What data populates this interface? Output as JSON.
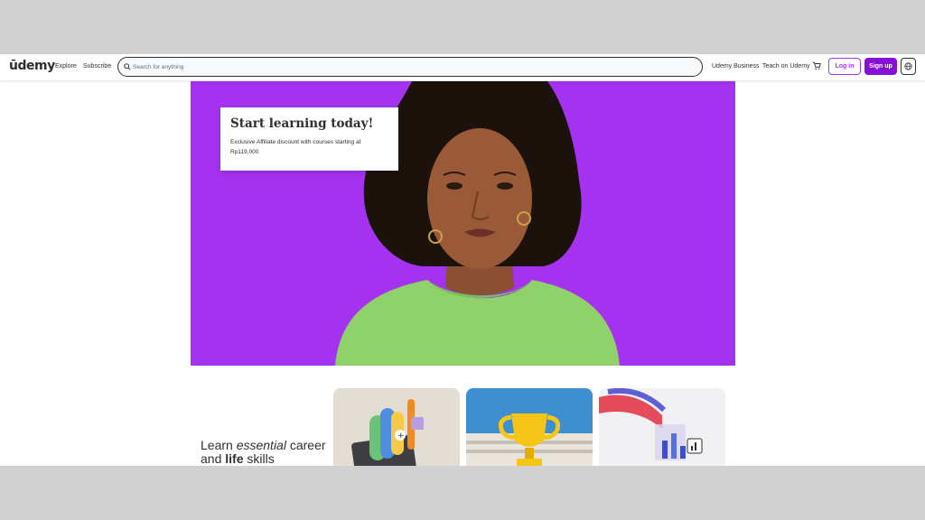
{
  "header": {
    "logo": "ūdemy",
    "nav": {
      "explore": "Explore",
      "subscribe": "Subscribe"
    },
    "search": {
      "placeholder": "Search for anything",
      "value": ""
    },
    "links": {
      "business": "Udemy Business",
      "teach": "Teach on Udemy"
    },
    "buttons": {
      "login": "Log in",
      "signup": "Sign up"
    }
  },
  "hero": {
    "title": "Start learning today!",
    "text_line1": "Exclusive Affiliate discount with courses starting at",
    "text_line2": "Rp119,000"
  },
  "tagline": {
    "learn": "Learn",
    "essential": "essential",
    "career": "career",
    "and": "and",
    "life": "life",
    "skills": "skills"
  },
  "colors": {
    "brand": "#a435f0",
    "signup_bg": "#8710d8",
    "hero_bg": "#a432f0",
    "text": "#2d2f31"
  },
  "icons": [
    "search-icon",
    "cart-icon",
    "globe-icon"
  ]
}
